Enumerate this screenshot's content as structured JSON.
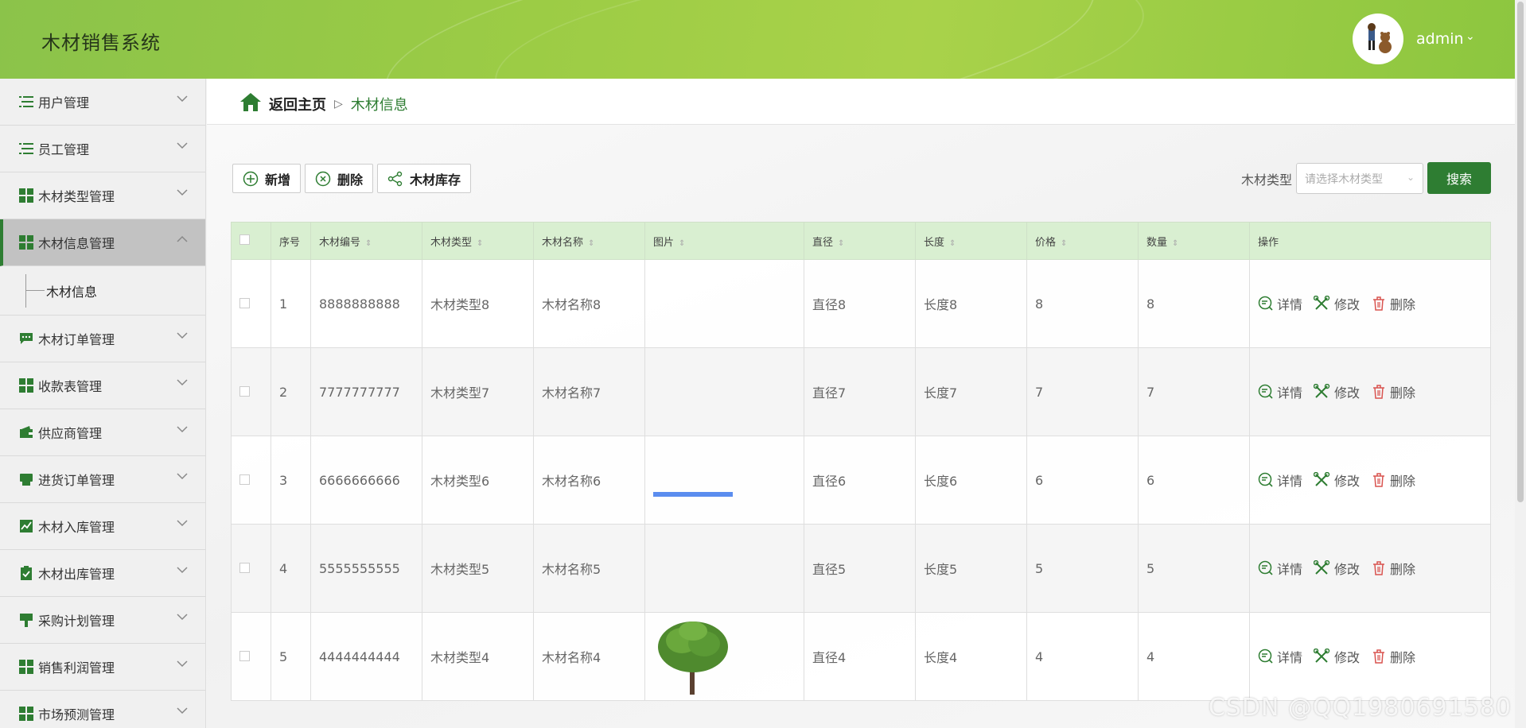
{
  "header": {
    "app_title": "木材销售系统",
    "user_name": "admin",
    "chevron": "⌄"
  },
  "sidebar": {
    "items": [
      {
        "label": "用户管理",
        "icon": "list-icon"
      },
      {
        "label": "员工管理",
        "icon": "list-icon"
      },
      {
        "label": "木材类型管理",
        "icon": "grid-icon"
      },
      {
        "label": "木材信息管理",
        "icon": "grid-icon",
        "active": true
      },
      {
        "label": "木材订单管理",
        "icon": "chat-icon"
      },
      {
        "label": "收款表管理",
        "icon": "grid-icon"
      },
      {
        "label": "供应商管理",
        "icon": "wallet-icon"
      },
      {
        "label": "进货订单管理",
        "icon": "printer-icon"
      },
      {
        "label": "木材入库管理",
        "icon": "chart-icon"
      },
      {
        "label": "木材出库管理",
        "icon": "clipboard-icon"
      },
      {
        "label": "采购计划管理",
        "icon": "pin-icon"
      },
      {
        "label": "销售利润管理",
        "icon": "grid-icon"
      },
      {
        "label": "市场预测管理",
        "icon": "grid-icon"
      }
    ],
    "sub_item": "木材信息"
  },
  "breadcrumb": {
    "home": "返回主页",
    "separator": "▷",
    "current": "木材信息"
  },
  "toolbar": {
    "add": "新增",
    "delete": "删除",
    "stock": "木材库存"
  },
  "search": {
    "label": "木材类型",
    "placeholder": "请选择木材类型",
    "button": "搜索"
  },
  "table": {
    "headers": [
      "序号",
      "木材编号",
      "木材类型",
      "木材名称",
      "图片",
      "直径",
      "长度",
      "价格",
      "数量",
      "操作"
    ],
    "rows": [
      {
        "idx": "1",
        "code": "8888888888",
        "type": "木材类型8",
        "name": "木材名称8",
        "image": "none",
        "diameter": "直径8",
        "length": "长度8",
        "price": "8",
        "qty": "8"
      },
      {
        "idx": "2",
        "code": "7777777777",
        "type": "木材类型7",
        "name": "木材名称7",
        "image": "none",
        "diameter": "直径7",
        "length": "长度7",
        "price": "7",
        "qty": "7"
      },
      {
        "idx": "3",
        "code": "6666666666",
        "type": "木材类型6",
        "name": "木材名称6",
        "image": "none",
        "diameter": "直径6",
        "length": "长度6",
        "price": "6",
        "qty": "6"
      },
      {
        "idx": "4",
        "code": "5555555555",
        "type": "木材类型5",
        "name": "木材名称5",
        "image": "loading",
        "diameter": "直径5",
        "length": "长度5",
        "price": "5",
        "qty": "5"
      },
      {
        "idx": "5",
        "code": "4444444444",
        "type": "木材类型4",
        "name": "木材名称4",
        "image": "tree",
        "diameter": "直径4",
        "length": "长度4",
        "price": "4",
        "qty": "4"
      }
    ],
    "ops": {
      "detail": "详情",
      "edit": "修改",
      "delete": "删除"
    }
  },
  "watermark": "CSDN @QQ1980691580",
  "colors": {
    "brand_green": "#2e7d32",
    "header_green": "#9ccc45",
    "table_header": "#d9efd1"
  }
}
